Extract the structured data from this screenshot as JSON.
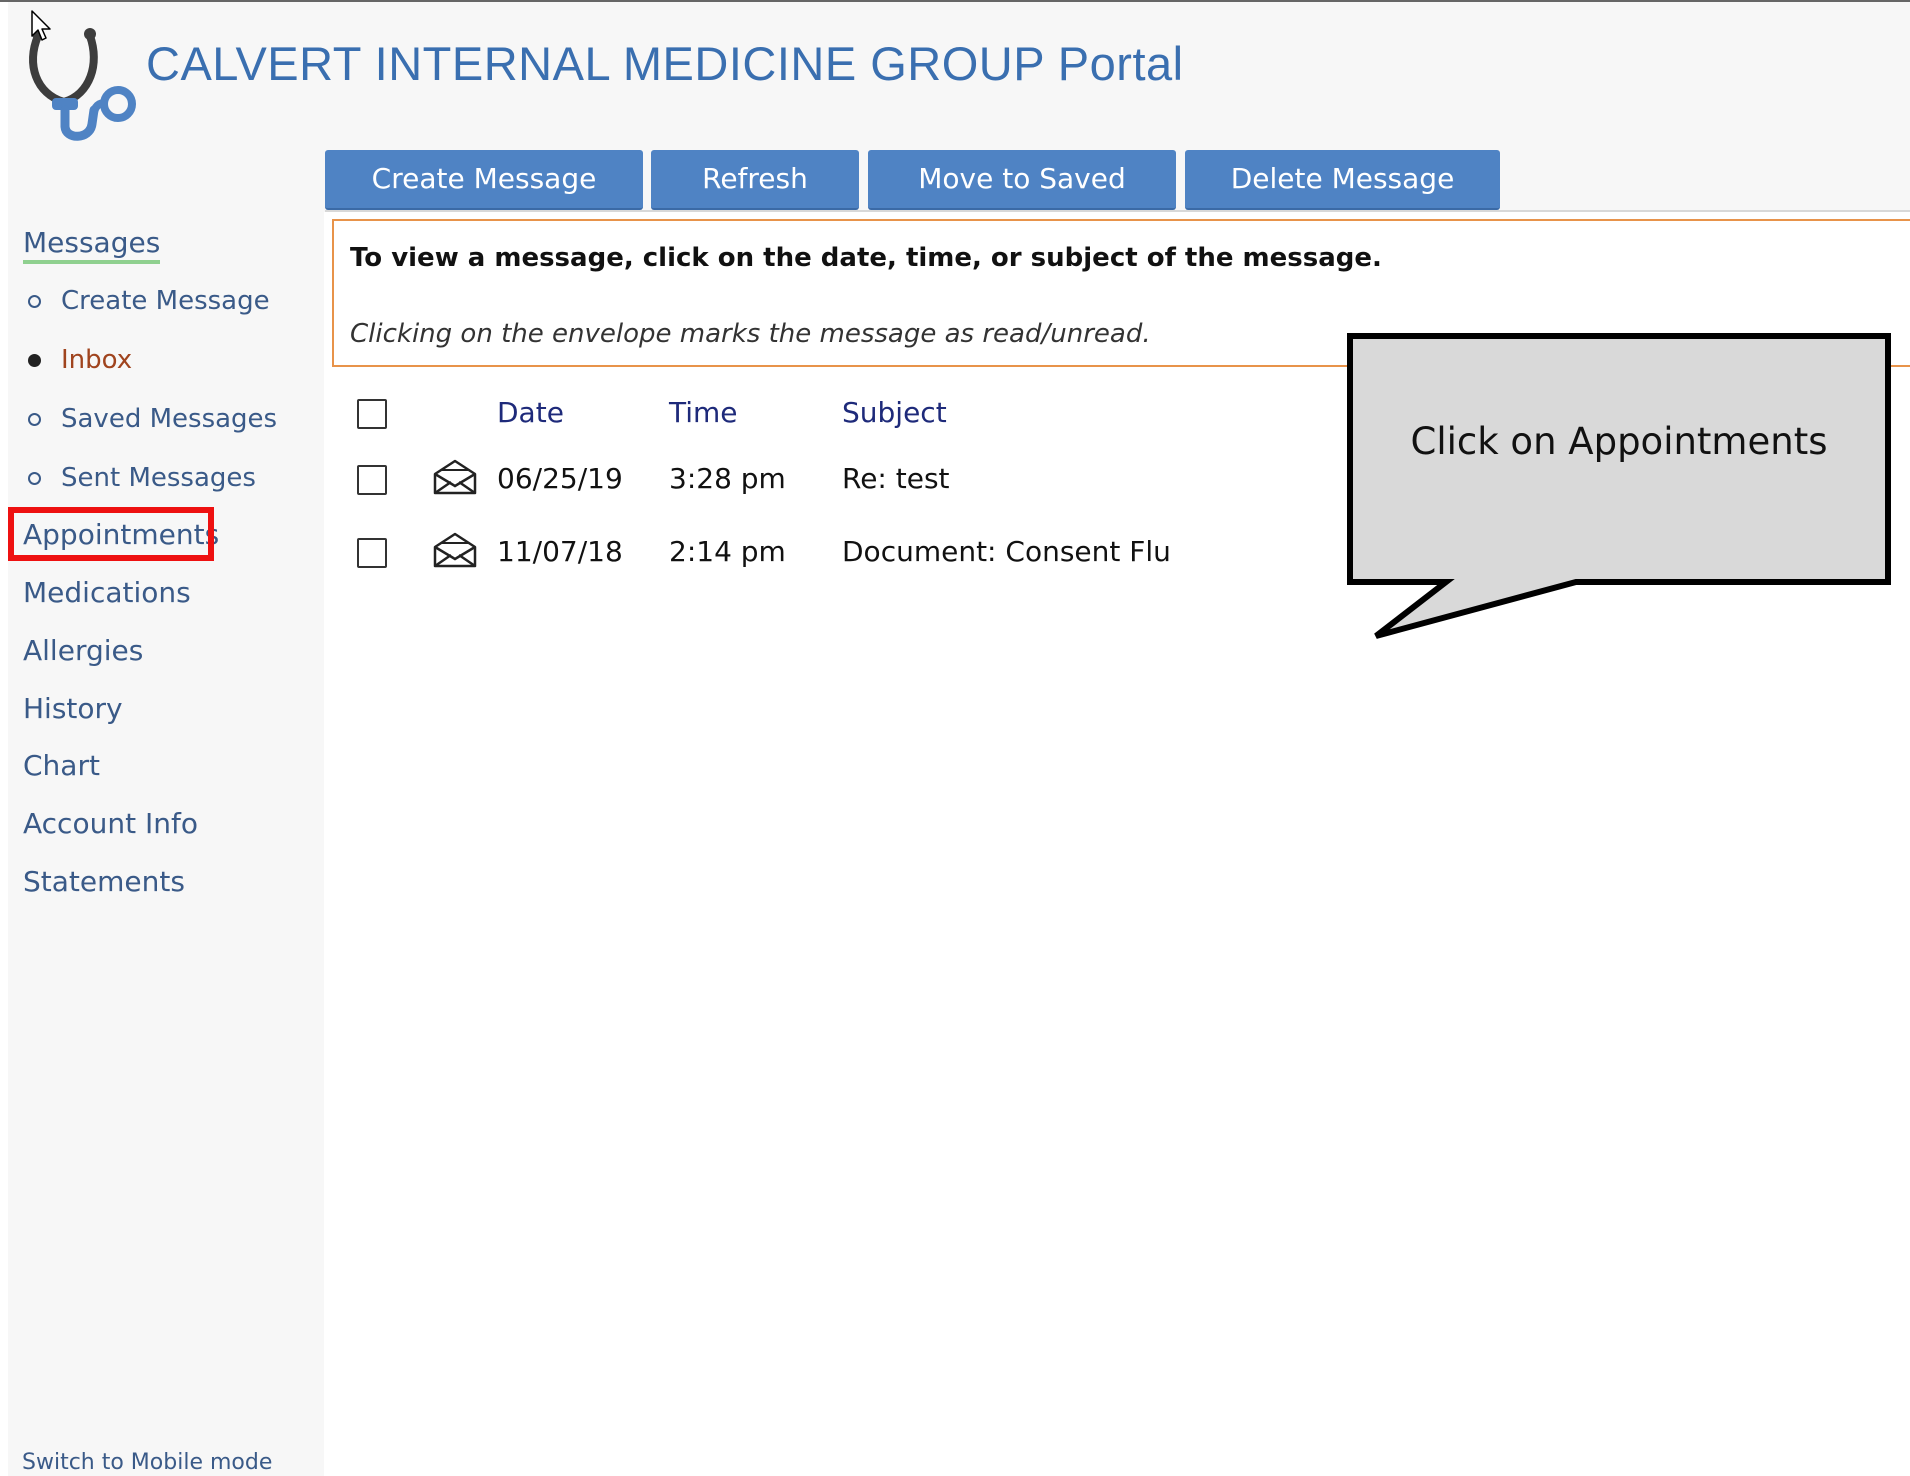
{
  "header": {
    "title": "CALVERT INTERNAL MEDICINE GROUP Portal",
    "logo_icon": "stethoscope-icon"
  },
  "toolbar": {
    "create_label": "Create Message",
    "refresh_label": "Refresh",
    "move_label": "Move to Saved",
    "delete_label": "Delete Message"
  },
  "sidebar": {
    "messages_label": "Messages",
    "sub_items": [
      {
        "label": "Create Message",
        "active": false
      },
      {
        "label": "Inbox",
        "active": true
      },
      {
        "label": "Saved Messages",
        "active": false
      },
      {
        "label": "Sent Messages",
        "active": false
      }
    ],
    "items": [
      {
        "label": "Appointments"
      },
      {
        "label": "Medications"
      },
      {
        "label": "Allergies"
      },
      {
        "label": "History"
      },
      {
        "label": "Chart"
      },
      {
        "label": "Account Info"
      },
      {
        "label": "Statements"
      }
    ],
    "switch_mobile": "Switch to Mobile mode"
  },
  "notice": {
    "bold": "To view a message, click on the date, time, or subject of the message.",
    "italic": "Clicking on the envelope marks the message as read/unread."
  },
  "messages_table": {
    "headers": {
      "date": "Date",
      "time": "Time",
      "subject": "Subject"
    },
    "rows": [
      {
        "date": "06/25/19",
        "time": "3:28 pm",
        "subject": "Re: test",
        "icon": "envelope-open-icon"
      },
      {
        "date": "11/07/18",
        "time": "2:14 pm",
        "subject": "Document: Consent Flu",
        "icon": "envelope-open-icon"
      }
    ]
  },
  "callout": {
    "text": "Click on Appointments"
  },
  "colors": {
    "brand_blue": "#3a6fb0",
    "button_blue": "#4f83c4",
    "notice_border": "#e8934a",
    "highlight_red": "#ee1111",
    "active_nav": "#a0441e"
  }
}
